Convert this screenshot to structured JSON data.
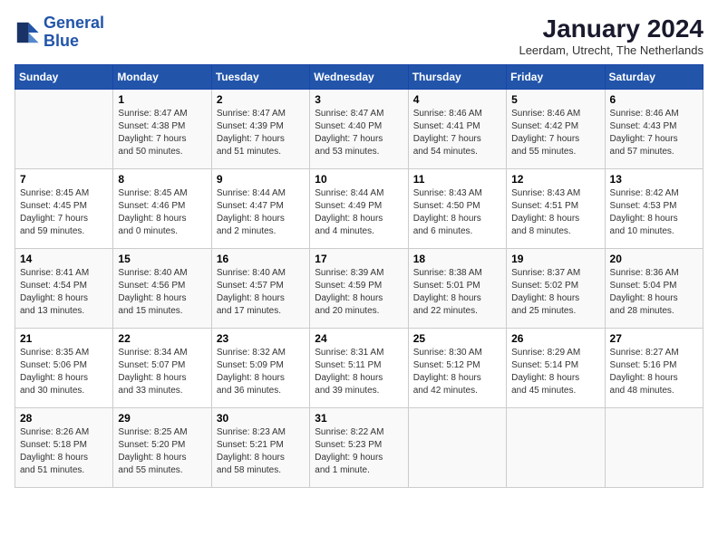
{
  "header": {
    "logo_line1": "General",
    "logo_line2": "Blue",
    "month": "January 2024",
    "location": "Leerdam, Utrecht, The Netherlands"
  },
  "weekdays": [
    "Sunday",
    "Monday",
    "Tuesday",
    "Wednesday",
    "Thursday",
    "Friday",
    "Saturday"
  ],
  "weeks": [
    [
      {
        "day": "",
        "info": ""
      },
      {
        "day": "1",
        "info": "Sunrise: 8:47 AM\nSunset: 4:38 PM\nDaylight: 7 hours\nand 50 minutes."
      },
      {
        "day": "2",
        "info": "Sunrise: 8:47 AM\nSunset: 4:39 PM\nDaylight: 7 hours\nand 51 minutes."
      },
      {
        "day": "3",
        "info": "Sunrise: 8:47 AM\nSunset: 4:40 PM\nDaylight: 7 hours\nand 53 minutes."
      },
      {
        "day": "4",
        "info": "Sunrise: 8:46 AM\nSunset: 4:41 PM\nDaylight: 7 hours\nand 54 minutes."
      },
      {
        "day": "5",
        "info": "Sunrise: 8:46 AM\nSunset: 4:42 PM\nDaylight: 7 hours\nand 55 minutes."
      },
      {
        "day": "6",
        "info": "Sunrise: 8:46 AM\nSunset: 4:43 PM\nDaylight: 7 hours\nand 57 minutes."
      }
    ],
    [
      {
        "day": "7",
        "info": "Sunrise: 8:45 AM\nSunset: 4:45 PM\nDaylight: 7 hours\nand 59 minutes."
      },
      {
        "day": "8",
        "info": "Sunrise: 8:45 AM\nSunset: 4:46 PM\nDaylight: 8 hours\nand 0 minutes."
      },
      {
        "day": "9",
        "info": "Sunrise: 8:44 AM\nSunset: 4:47 PM\nDaylight: 8 hours\nand 2 minutes."
      },
      {
        "day": "10",
        "info": "Sunrise: 8:44 AM\nSunset: 4:49 PM\nDaylight: 8 hours\nand 4 minutes."
      },
      {
        "day": "11",
        "info": "Sunrise: 8:43 AM\nSunset: 4:50 PM\nDaylight: 8 hours\nand 6 minutes."
      },
      {
        "day": "12",
        "info": "Sunrise: 8:43 AM\nSunset: 4:51 PM\nDaylight: 8 hours\nand 8 minutes."
      },
      {
        "day": "13",
        "info": "Sunrise: 8:42 AM\nSunset: 4:53 PM\nDaylight: 8 hours\nand 10 minutes."
      }
    ],
    [
      {
        "day": "14",
        "info": "Sunrise: 8:41 AM\nSunset: 4:54 PM\nDaylight: 8 hours\nand 13 minutes."
      },
      {
        "day": "15",
        "info": "Sunrise: 8:40 AM\nSunset: 4:56 PM\nDaylight: 8 hours\nand 15 minutes."
      },
      {
        "day": "16",
        "info": "Sunrise: 8:40 AM\nSunset: 4:57 PM\nDaylight: 8 hours\nand 17 minutes."
      },
      {
        "day": "17",
        "info": "Sunrise: 8:39 AM\nSunset: 4:59 PM\nDaylight: 8 hours\nand 20 minutes."
      },
      {
        "day": "18",
        "info": "Sunrise: 8:38 AM\nSunset: 5:01 PM\nDaylight: 8 hours\nand 22 minutes."
      },
      {
        "day": "19",
        "info": "Sunrise: 8:37 AM\nSunset: 5:02 PM\nDaylight: 8 hours\nand 25 minutes."
      },
      {
        "day": "20",
        "info": "Sunrise: 8:36 AM\nSunset: 5:04 PM\nDaylight: 8 hours\nand 28 minutes."
      }
    ],
    [
      {
        "day": "21",
        "info": "Sunrise: 8:35 AM\nSunset: 5:06 PM\nDaylight: 8 hours\nand 30 minutes."
      },
      {
        "day": "22",
        "info": "Sunrise: 8:34 AM\nSunset: 5:07 PM\nDaylight: 8 hours\nand 33 minutes."
      },
      {
        "day": "23",
        "info": "Sunrise: 8:32 AM\nSunset: 5:09 PM\nDaylight: 8 hours\nand 36 minutes."
      },
      {
        "day": "24",
        "info": "Sunrise: 8:31 AM\nSunset: 5:11 PM\nDaylight: 8 hours\nand 39 minutes."
      },
      {
        "day": "25",
        "info": "Sunrise: 8:30 AM\nSunset: 5:12 PM\nDaylight: 8 hours\nand 42 minutes."
      },
      {
        "day": "26",
        "info": "Sunrise: 8:29 AM\nSunset: 5:14 PM\nDaylight: 8 hours\nand 45 minutes."
      },
      {
        "day": "27",
        "info": "Sunrise: 8:27 AM\nSunset: 5:16 PM\nDaylight: 8 hours\nand 48 minutes."
      }
    ],
    [
      {
        "day": "28",
        "info": "Sunrise: 8:26 AM\nSunset: 5:18 PM\nDaylight: 8 hours\nand 51 minutes."
      },
      {
        "day": "29",
        "info": "Sunrise: 8:25 AM\nSunset: 5:20 PM\nDaylight: 8 hours\nand 55 minutes."
      },
      {
        "day": "30",
        "info": "Sunrise: 8:23 AM\nSunset: 5:21 PM\nDaylight: 8 hours\nand 58 minutes."
      },
      {
        "day": "31",
        "info": "Sunrise: 8:22 AM\nSunset: 5:23 PM\nDaylight: 9 hours\nand 1 minute."
      },
      {
        "day": "",
        "info": ""
      },
      {
        "day": "",
        "info": ""
      },
      {
        "day": "",
        "info": ""
      }
    ]
  ]
}
